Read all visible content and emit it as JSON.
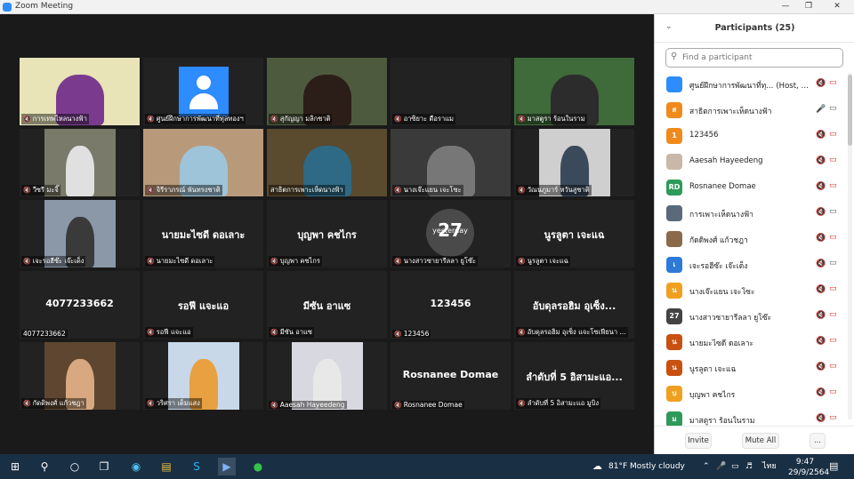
{
  "window": {
    "title": "Zoom Meeting"
  },
  "gallery": {
    "tiles": [
      {
        "name": "การเทพไหลนางฟ้า",
        "muted": true,
        "display": "video",
        "video_bg": "#e8e4b8",
        "video_fg": "#7a3b8f"
      },
      {
        "name": "ศูนย์ฝึกษาการพัฒนาที่ทุลทองฯ",
        "muted": true,
        "display": "avatar"
      },
      {
        "name": "สุกัญญา มลิกชาติ",
        "muted": true,
        "display": "video",
        "video_bg": "#4e5a3e",
        "video_fg": "#2b1e18"
      },
      {
        "name": "อาซิยาะ ดือราแม",
        "muted": true,
        "display": "dark"
      },
      {
        "name": "มาสตูรา ร้อนในราม",
        "muted": true,
        "display": "video",
        "video_bg": "#3f6a3a",
        "video_fg": "#2c2c2c"
      },
      {
        "name": "วีซรี มะจิ๊",
        "muted": true,
        "display": "video-narrow",
        "video_bg": "#7a7a6a",
        "video_fg": "#e0e0e0"
      },
      {
        "name": "จิรีราภรณ์ พันทรงชาติ",
        "muted": true,
        "display": "video",
        "video_bg": "#b89a7a",
        "video_fg": "#9dc4d8"
      },
      {
        "name": "สาธิตการเพาะเห็ดนางฟ้า",
        "muted": false,
        "display": "video",
        "video_bg": "#5a4a2e",
        "video_fg": "#2e6a86",
        "active": true
      },
      {
        "name": "นางเจ๊ะแยน เจะโซะ",
        "muted": true,
        "display": "video",
        "video_bg": "#3a3a3a",
        "video_fg": "#777777"
      },
      {
        "name": "วัณนภูมาร์ หวันสูชาติ",
        "muted": true,
        "display": "video-narrow",
        "video_bg": "#cfcfcf",
        "video_fg": "#3a4a5a"
      },
      {
        "name": "เจะรอฮีซ๊ะ เจ๊ะเด็ง",
        "muted": true,
        "display": "video-narrow",
        "video_bg": "#8a98a8",
        "video_fg": "#3a3a3a"
      },
      {
        "name": "นายมะไซดี ดอเลาะ",
        "muted": true,
        "display": "text",
        "big": "นายมะไซดี ดอเลาะ"
      },
      {
        "name": "บุญพา คชไกร",
        "muted": true,
        "display": "text",
        "big": "บุญพา คชไกร"
      },
      {
        "name": "นางสาวซายารีลลา ยูโซ๊ะ",
        "muted": true,
        "display": "circle",
        "big": "yesterday",
        "badge": "27"
      },
      {
        "name": "นูรลูตา เจะแฉ",
        "muted": true,
        "display": "text",
        "big": "นูรลูตา เจะแฉ"
      },
      {
        "name": "4077233662",
        "muted": false,
        "display": "text",
        "big": "4077233662"
      },
      {
        "name": "รอฟี แจะแอ",
        "muted": true,
        "display": "text",
        "big": "รอฟี แจะแอ"
      },
      {
        "name": "มีซัน อาแซ",
        "muted": true,
        "display": "text",
        "big": "มีซัน อาแซ"
      },
      {
        "name": "123456",
        "muted": true,
        "display": "text",
        "big": "123456"
      },
      {
        "name": "อับดุลรอฮิม อุเซ็ง แจะโซเฟียนา ...",
        "muted": true,
        "display": "text",
        "big": "อับดุลรอฮิม อุเซ็ง..."
      },
      {
        "name": "กัดดิพงศ์ แก้วชฎา",
        "muted": true,
        "display": "photo",
        "video_bg": "#5e4630",
        "video_fg": "#d8a880"
      },
      {
        "name": "วริศรา เต็มแสง",
        "muted": true,
        "display": "photo",
        "video_bg": "#c8d8e8",
        "video_fg": "#e8a040"
      },
      {
        "name": "Aaesah Hayeedeng",
        "muted": true,
        "display": "photo",
        "video_bg": "#d8d8e0",
        "video_fg": "#e8e8e8"
      },
      {
        "name": "Rosnanee Domae",
        "muted": true,
        "display": "text",
        "big": "Rosnanee Domae"
      },
      {
        "name": "ลำดับที่ 5 อิสามะแอ มูบิง",
        "muted": true,
        "display": "text",
        "big": "ลำดับที่ 5 อิสามะแอ..."
      }
    ]
  },
  "participants": {
    "title": "Participants (25)",
    "search_placeholder": "Find a participant",
    "list": [
      {
        "name": "ศูนย์ฝึกษาการพัฒนาที่ทุ...",
        "suffix": "(Host, me)",
        "initial": "",
        "color": "#2d8cff",
        "mic": "muted",
        "cam": "off"
      },
      {
        "name": "สาธิตการเพาะเห็ดนางฟ้า",
        "initial": "ส",
        "color": "#f08a1c",
        "mic": "on",
        "cam": "on"
      },
      {
        "name": "123456",
        "initial": "1",
        "color": "#f08a1c",
        "mic": "muted",
        "cam": "off"
      },
      {
        "name": "Aaesah Hayeedeng",
        "initial": "",
        "color": "#c9b8a8",
        "mic": "muted",
        "cam": "off"
      },
      {
        "name": "Rosnanee Domae",
        "initial": "RD",
        "color": "#2e9a5a",
        "mic": "muted",
        "cam": "off"
      },
      {
        "name": "การเพาะเห็ดนางฟ้า",
        "initial": "",
        "color": "#5a6a7a",
        "mic": "muted",
        "cam": "on"
      },
      {
        "name": "กัดดิพงศ์ แก้วชฎา",
        "initial": "",
        "color": "#8a6a4a",
        "mic": "muted",
        "cam": "off"
      },
      {
        "name": "เจะรอฮีซ๊ะ เจ๊ะเด็ง",
        "initial": "เ",
        "color": "#2d7ad8",
        "mic": "muted",
        "cam": "on"
      },
      {
        "name": "นางเจ๊ะแยน เจะโซะ",
        "initial": "น",
        "color": "#f0a020",
        "mic": "muted",
        "cam": "off"
      },
      {
        "name": "นางสาวซายารีลลา ยูโซ๊ะ",
        "initial": "27",
        "color": "#444444",
        "mic": "muted",
        "cam": "off"
      },
      {
        "name": "นายมะไซดี ดอเลาะ",
        "initial": "น",
        "color": "#c85010",
        "mic": "muted",
        "cam": "off"
      },
      {
        "name": "นูรลูตา เจะแฉ",
        "initial": "น",
        "color": "#c85010",
        "mic": "muted",
        "cam": "off"
      },
      {
        "name": "บุญพา คชไกร",
        "initial": "บ",
        "color": "#f0a020",
        "mic": "muted",
        "cam": "off"
      },
      {
        "name": "มาสตูรา ร้อนในราม",
        "initial": "ม",
        "color": "#2e9a5a",
        "mic": "muted",
        "cam": "off"
      }
    ],
    "footer": {
      "invite": "Invite",
      "mute_all": "Mute All",
      "more": "..."
    }
  },
  "taskbar": {
    "weather": "81°F  Mostly cloudy",
    "language": "ไทย",
    "time": "9:47",
    "date": "29/9/2564"
  }
}
